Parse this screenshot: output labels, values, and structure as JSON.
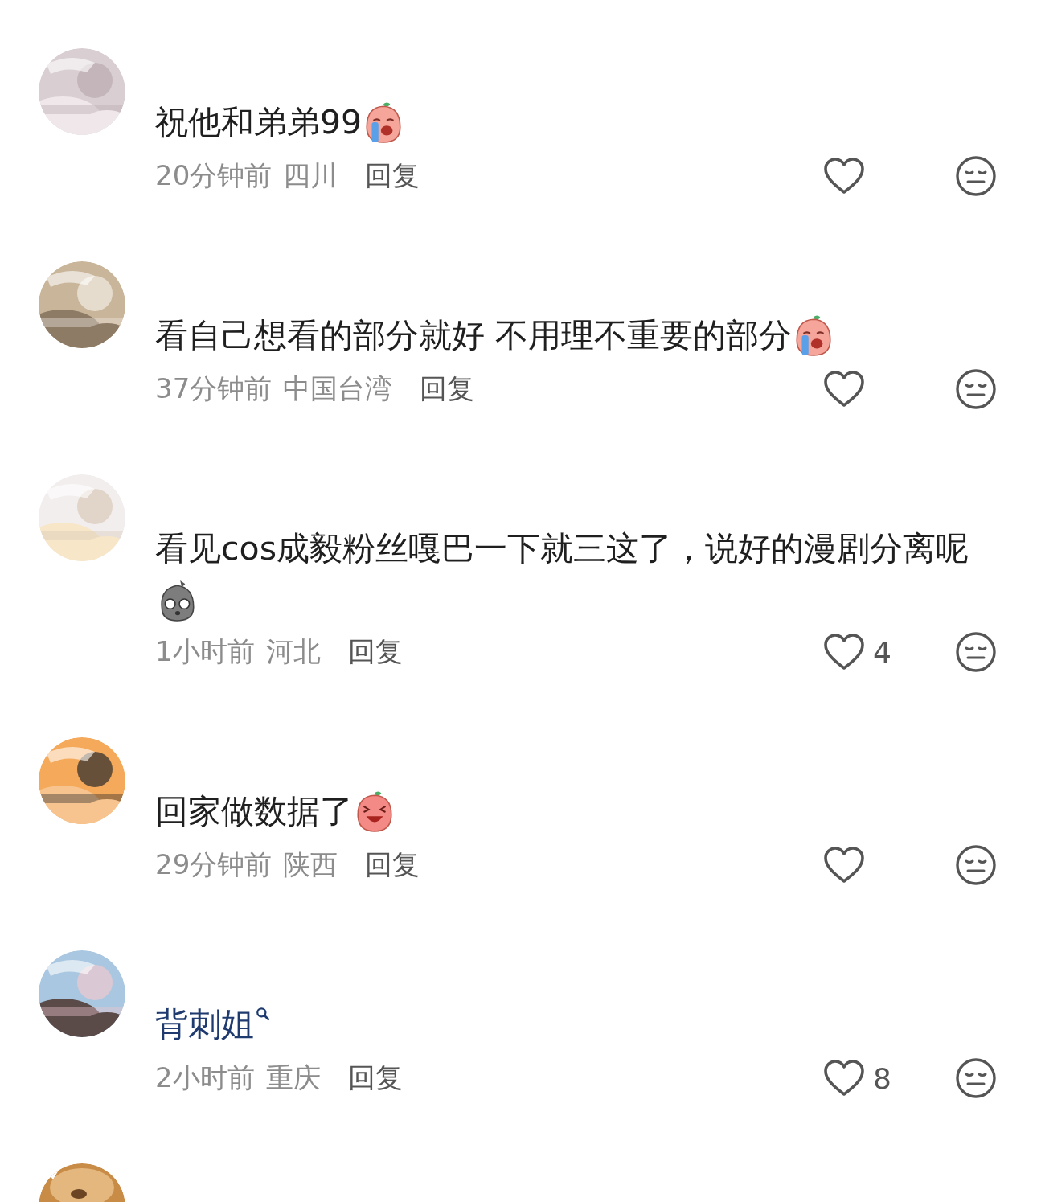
{
  "comments": [
    {
      "kind": "text",
      "text": "祝他和弟弟99",
      "sticker": {
        "kind": "crying"
      },
      "time": "20分钟前",
      "location": "四川",
      "reply": "回复"
    },
    {
      "kind": "text",
      "text": "看自己想看的部分就好 不用理不重要的部分",
      "sticker": {
        "kind": "crying"
      },
      "time": "37分钟前",
      "location": "中国台湾",
      "reply": "回复"
    },
    {
      "kind": "text",
      "text": "看见cos成毅粉丝嘎巴一下就三这了，说好的漫剧分离呢",
      "sticker": {
        "kind": "stone"
      },
      "time": "1小时前",
      "location": "河北",
      "reply": "回复",
      "likes": "4"
    },
    {
      "kind": "text",
      "text": "回家做数据了",
      "sticker": {
        "kind": "laughing"
      },
      "time": "29分钟前",
      "location": "陕西",
      "reply": "回复"
    },
    {
      "kind": "search_link",
      "text": "背刺姐",
      "time": "2小时前",
      "location": "重庆",
      "reply": "回复",
      "likes": "8"
    }
  ],
  "more_below": true
}
